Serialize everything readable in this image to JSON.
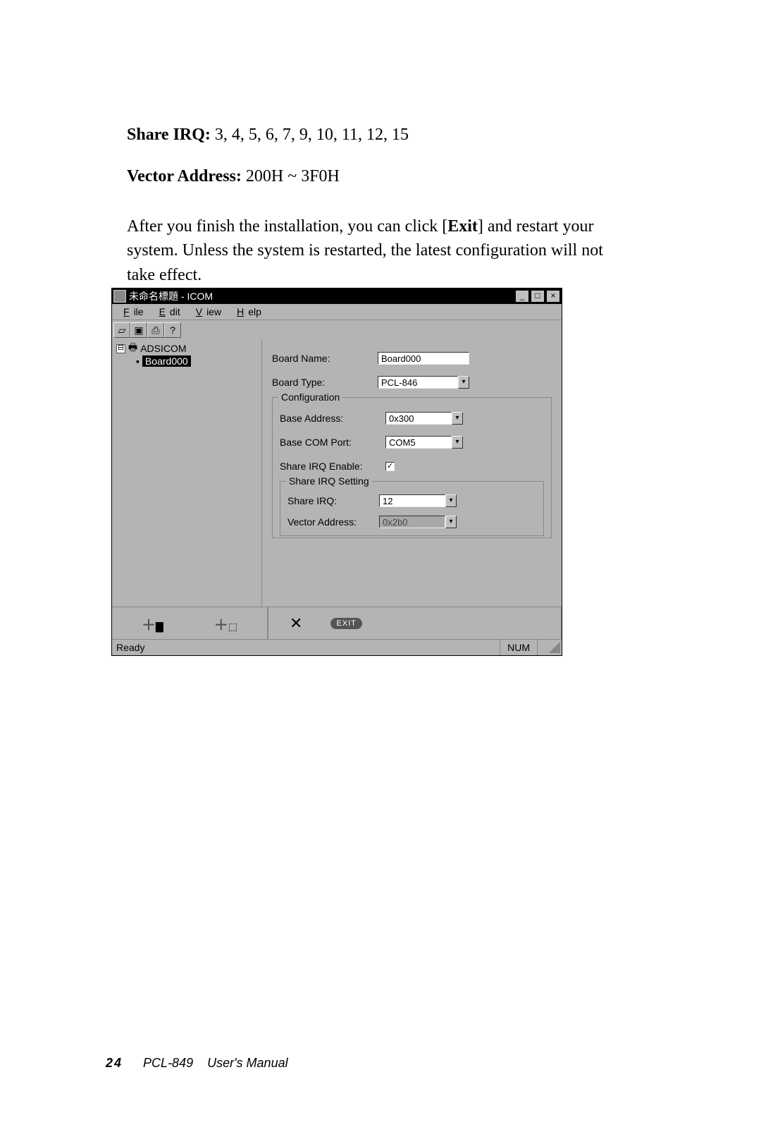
{
  "doc": {
    "share_irq_label": "Share IRQ: ",
    "share_irq_values": "3, 4, 5, 6, 7, 9, 10, 11, 12, 15",
    "vector_label": "Vector Address: ",
    "vector_values": "200H ~ 3F0H",
    "paragraph_pre": "After you finish the installation, you can click [",
    "paragraph_bold": "Exit",
    "paragraph_post": "] and restart your system. Unless the system is restarted, the latest configuration will not take effect."
  },
  "window": {
    "title": "未命名標題 - ICOM",
    "menu": {
      "file": "File",
      "edit": "Edit",
      "view": "View",
      "help": "Help"
    },
    "toolbar_icons": {
      "new": "◻",
      "save": "▣",
      "print": "⌫",
      "help": "?"
    },
    "tree": {
      "root": "ADSICOM",
      "child": "Board000",
      "expander": "⊟"
    },
    "form": {
      "board_name_label": "Board Name:",
      "board_name_value": "Board000",
      "board_type_label": "Board Type:",
      "board_type_value": "PCL-846",
      "group_config": "Configuration",
      "base_address_label": "Base Address:",
      "base_address_value": "0x300",
      "base_com_label": "Base COM Port:",
      "base_com_value": "COM5",
      "share_irq_enable_label": "Share IRQ Enable:",
      "share_irq_enable_checked": "✓",
      "group_share": "Share IRQ Setting",
      "share_irq_label": "Share IRQ:",
      "share_irq_value": "12",
      "vector_label": "Vector Address:",
      "vector_value": "0x2b0"
    },
    "bottom": {
      "add_board": "＋",
      "add_port": "＋",
      "delete": "✕",
      "exit": "EXIT"
    },
    "status": {
      "ready": "Ready",
      "num": "NUM"
    },
    "dropdown_arrow": "▾"
  },
  "footer": {
    "page": "24",
    "model": "PCL-849",
    "title": "User's Manual"
  }
}
